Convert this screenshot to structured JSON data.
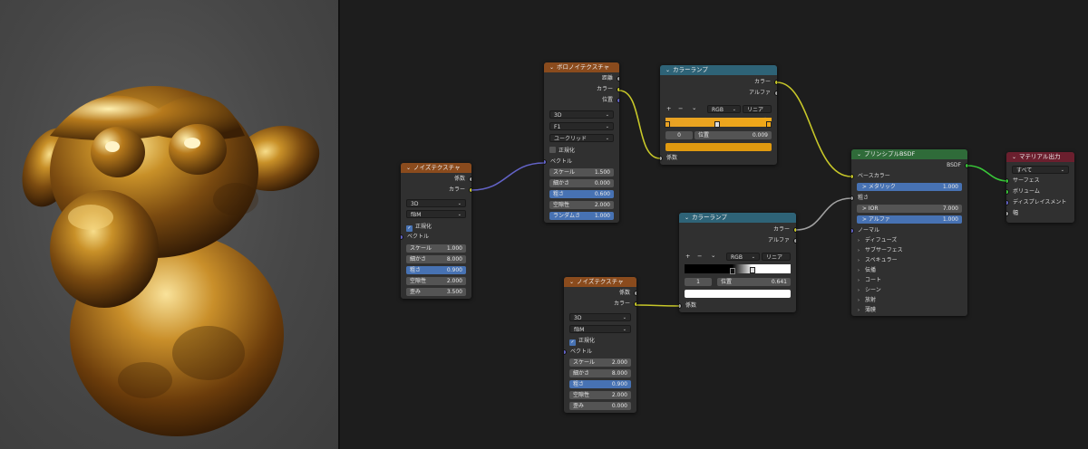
{
  "noise1": {
    "title": "ノイズテクスチャ",
    "out_fac": "係数",
    "out_color": "カラー",
    "dim": "3D",
    "type": "fBM",
    "normalize": "正規化",
    "in_vector": "ベクトル",
    "scale_lbl": "スケール",
    "scale": "1.000",
    "detail_lbl": "細かさ",
    "detail": "8.000",
    "rough_lbl": "粗さ",
    "rough": "0.900",
    "lac_lbl": "空隙性",
    "lac": "2.000",
    "distort_lbl": "歪み",
    "distort": "3.500"
  },
  "voronoi": {
    "title": "ボロノイテクスチャ",
    "out_dist": "距離",
    "out_color": "カラー",
    "out_pos": "位置",
    "dim": "3D",
    "feature": "F1",
    "metric": "ユークリッド",
    "normalize": "正規化",
    "in_vector": "ベクトル",
    "scale_lbl": "スケール",
    "scale": "1.500",
    "detail_lbl": "細かさ",
    "detail": "0.000",
    "rough_lbl": "粗さ",
    "rough": "0.600",
    "lac_lbl": "空隙性",
    "lac": "2.000",
    "rand_lbl": "ランダムさ",
    "rand": "1.000"
  },
  "ramp1": {
    "title": "カラーランプ",
    "out_color": "カラー",
    "out_alpha": "アルファ",
    "plus": "+",
    "minus": "−",
    "chev": "⌄",
    "mode": "RGB",
    "interp": "リニア",
    "index": "0",
    "pos_lbl": "位置",
    "pos": "0.009",
    "in_fac": "係数",
    "colors": {
      "bar_left": "#e8a224",
      "bar_right": "#f0a818",
      "swatch": "#e09a10"
    }
  },
  "ramp2": {
    "title": "カラーランプ",
    "out_color": "カラー",
    "out_alpha": "アルファ",
    "plus": "+",
    "minus": "−",
    "chev": "⌄",
    "mode": "RGB",
    "interp": "リニア",
    "index": "1",
    "pos_lbl": "位置",
    "pos": "0.641",
    "in_fac": "係数",
    "colors": {
      "swatch": "#ffffff"
    }
  },
  "noise2": {
    "title": "ノイズテクスチャ",
    "out_fac": "係数",
    "out_color": "カラー",
    "dim": "3D",
    "type": "fBM",
    "normalize": "正規化",
    "in_vector": "ベクトル",
    "scale_lbl": "スケール",
    "scale": "2.000",
    "detail_lbl": "細かさ",
    "detail": "8.000",
    "rough_lbl": "粗さ",
    "rough": "0.900",
    "lac_lbl": "空隙性",
    "lac": "2.000",
    "distort_lbl": "歪み",
    "distort": "0.000"
  },
  "bsdf": {
    "title": "プリンシプルBSDF",
    "out_bsdf": "BSDF",
    "base_color": "ベースカラー",
    "metallic_lbl": "メタリック",
    "metallic": "1.000",
    "roughness": "粗さ",
    "ior_lbl": "IOR",
    "ior": "7.000",
    "alpha_lbl": "アルファ",
    "alpha": "1.000",
    "normal": "ノーマル",
    "panels": [
      "ディフューズ",
      "サブサーフェス",
      "スペキュラー",
      "伝播",
      "コート",
      "シーン",
      "放射",
      "薄膜"
    ]
  },
  "output": {
    "title": "マテリアル出力",
    "target": "すべて",
    "surface": "サーフェス",
    "volume": "ボリューム",
    "displacement": "ディスプレイスメント",
    "thickness": "幅"
  },
  "colors": {
    "wire_yellow": "#c7c729",
    "wire_gray": "#a1a1a1",
    "wire_blue": "#6363c7",
    "wire_green": "#39c739",
    "accent": "#4772b3"
  }
}
